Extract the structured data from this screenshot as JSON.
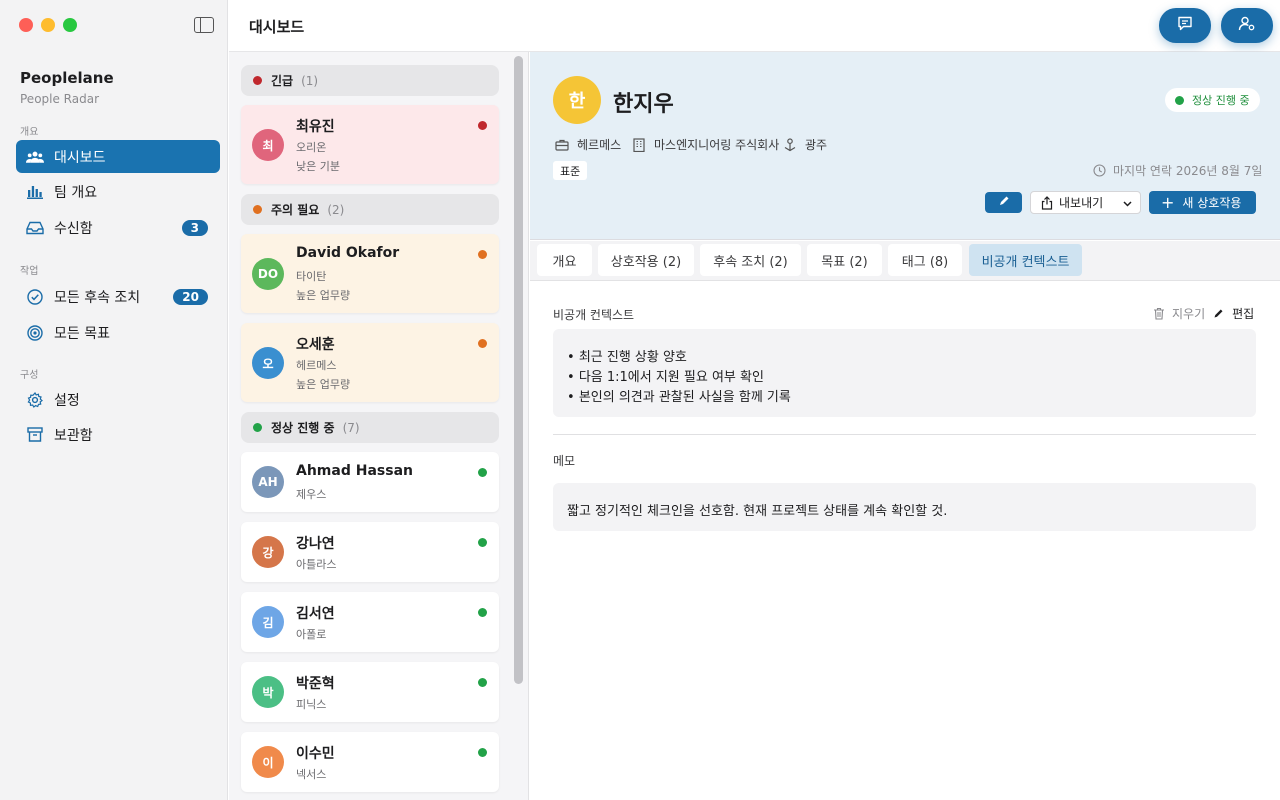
{
  "sidebar": {
    "app_title": "Peoplelane",
    "app_subtitle": "People Radar",
    "section_overview": "개요",
    "section_work": "작업",
    "section_config": "구성",
    "items": [
      {
        "label": "대시보드",
        "icon": "people-icon"
      },
      {
        "label": "팀 개요",
        "icon": "chart-icon"
      },
      {
        "label": "수신함",
        "icon": "inbox-icon",
        "badge": "3"
      },
      {
        "label": "모든 후속 조치",
        "icon": "checkmark-circle-icon",
        "badge": "20"
      },
      {
        "label": "모든 목표",
        "icon": "target-icon"
      },
      {
        "label": "설정",
        "icon": "gear-icon"
      },
      {
        "label": "보관함",
        "icon": "archive-icon"
      }
    ]
  },
  "toolbar": {
    "title": "대시보드",
    "buttons": [
      "chat-icon",
      "person-gear-icon"
    ]
  },
  "list": {
    "groups": [
      {
        "label": "긴급",
        "count": "(1)",
        "color": "#c0282d"
      },
      {
        "label": "주의 필요",
        "count": "(2)",
        "color": "#e07020"
      },
      {
        "label": "정상 진행 중",
        "count": "(7)",
        "color": "#22a248"
      }
    ],
    "people": [
      {
        "initials": "최",
        "name": "최유진",
        "company": "오리온",
        "mood": "낮은 기분",
        "av_color": "#e0657c",
        "dot": "#c0282d"
      },
      {
        "initials": "DO",
        "name": "David Okafor",
        "company": "타이탄",
        "mood": "높은 업무량",
        "av_color": "#5cb85c",
        "dot": "#e07020"
      },
      {
        "initials": "오",
        "name": "오세훈",
        "company": "헤르메스",
        "mood": "높은 업무량",
        "av_color": "#3a8fd0",
        "dot": "#e07020"
      },
      {
        "initials": "AH",
        "name": "Ahmad Hassan",
        "company": "제우스",
        "mood": "",
        "av_color": "#7b97b9",
        "dot": "#22a248"
      },
      {
        "initials": "강",
        "name": "강나연",
        "company": "아틀라스",
        "mood": "",
        "av_color": "#d5764a",
        "dot": "#22a248"
      },
      {
        "initials": "김",
        "name": "김서연",
        "company": "아폴로",
        "mood": "",
        "av_color": "#6ea6e6",
        "dot": "#22a248"
      },
      {
        "initials": "박",
        "name": "박준혁",
        "company": "피닉스",
        "mood": "",
        "av_color": "#4bbf85",
        "dot": "#22a248"
      },
      {
        "initials": "이",
        "name": "이수민",
        "company": "넥서스",
        "mood": "",
        "av_color": "#f08a4b",
        "dot": "#22a248"
      }
    ]
  },
  "detail": {
    "initial": "한",
    "name": "한지우",
    "status": "정상 진행 중",
    "team": "헤르메스",
    "company": "마스엔지니어링 주식회사",
    "location": "광주",
    "tag": "표준",
    "last_contact": "마지막 연락 2026년 8월 7일",
    "export_label": "내보내기",
    "new_interaction_label": "새 상호작용",
    "tabs": [
      "개요",
      "상호작용 (2)",
      "후속 조치 (2)",
      "목표 (2)",
      "태그 (8)",
      "비공개 컨텍스트"
    ],
    "private_title": "비공개 컨텍스트",
    "clear_label": "지우기",
    "edit_label": "편집",
    "bullets": [
      "최근 진행 상황 양호",
      "다음 1:1에서 지원 필요 여부 확인",
      "본인의 의견과 관찰된 사실을 함께 기록"
    ],
    "memo_title": "메모",
    "memo_text": "짧고 정기적인 체크인을 선호함. 현재 프로젝트 상태를 계속 확인할 것."
  }
}
